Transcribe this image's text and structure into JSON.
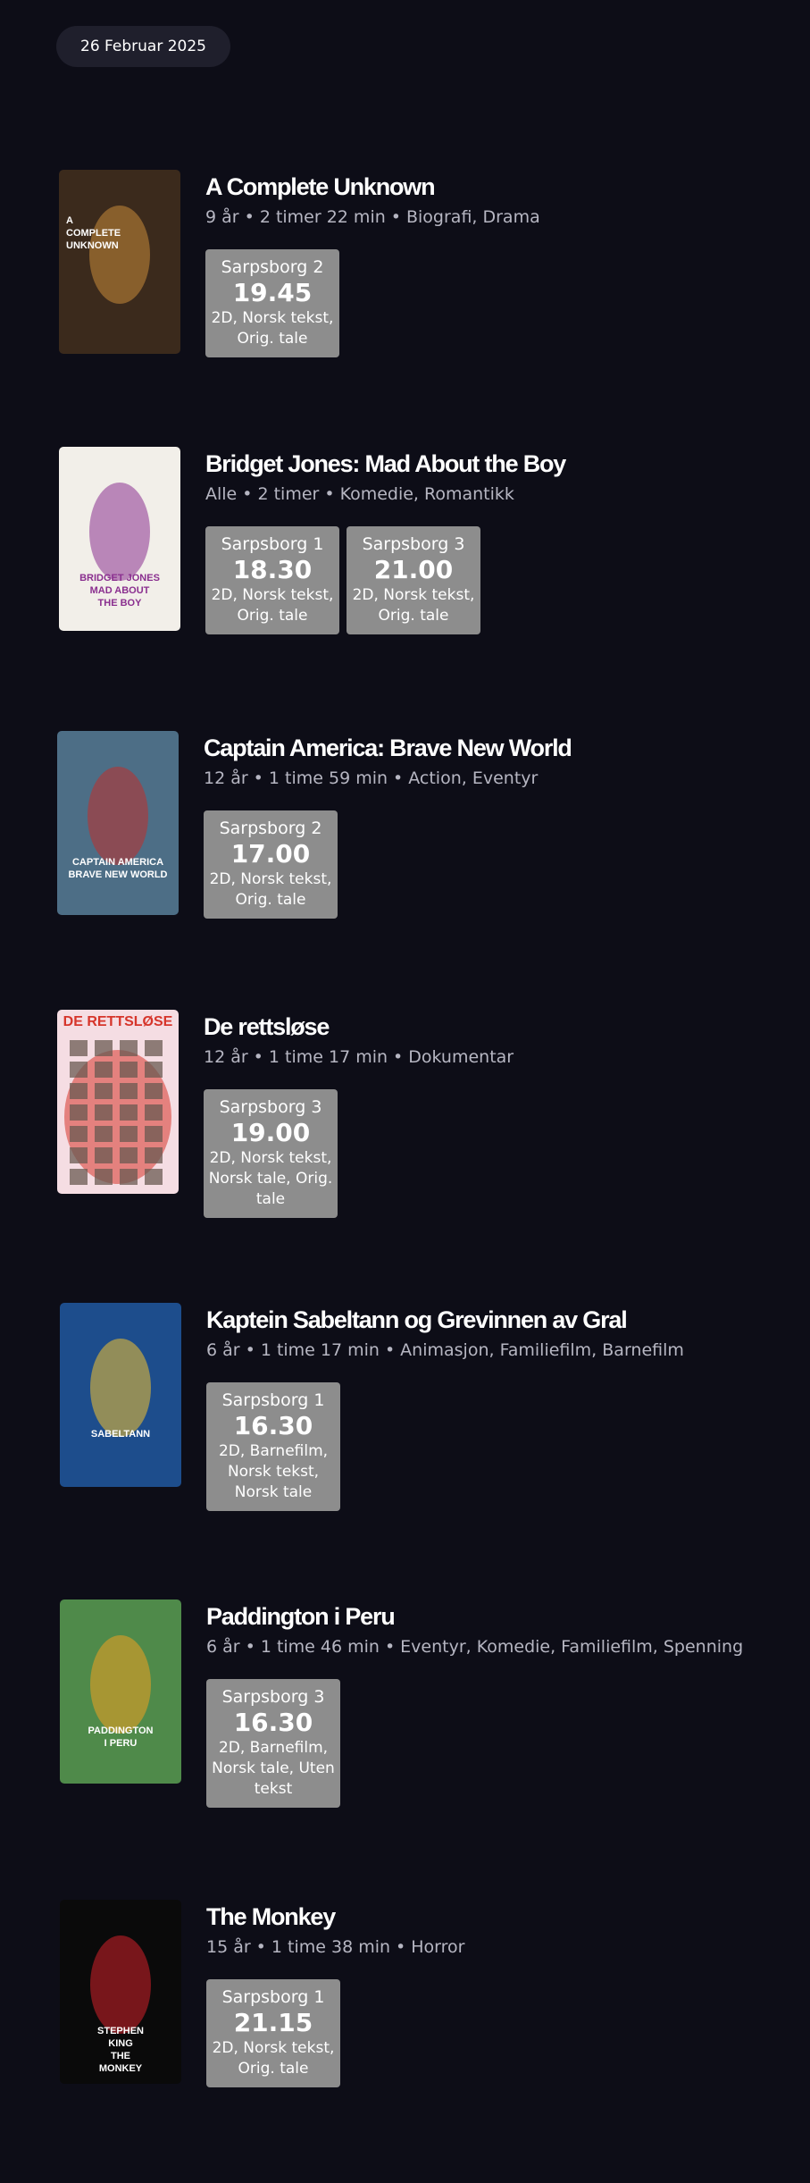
{
  "date": "26 Februar 2025",
  "movies": [
    {
      "title": "A Complete Unknown",
      "age": "9 år",
      "duration": "2 timer 22 min",
      "genres": "Biografi, Drama",
      "sessions": [
        {
          "hall": "Sarpsborg 2",
          "time": "19.45",
          "attr1": "2D, Norsk tekst,",
          "attr2": "Orig. tale",
          "attr3": ""
        }
      ]
    },
    {
      "title": "Bridget Jones: Mad About the Boy",
      "age": "Alle",
      "duration": "2 timer",
      "genres": "Komedie, Romantikk",
      "sessions": [
        {
          "hall": "Sarpsborg 1",
          "time": "18.30",
          "attr1": "2D, Norsk tekst,",
          "attr2": "Orig. tale",
          "attr3": ""
        },
        {
          "hall": "Sarpsborg 3",
          "time": "21.00",
          "attr1": "2D, Norsk tekst,",
          "attr2": "Orig. tale",
          "attr3": ""
        }
      ]
    },
    {
      "title": "Captain America: Brave New World",
      "age": "12 år",
      "duration": "1 time 59 min",
      "genres": "Action, Eventyr",
      "sessions": [
        {
          "hall": "Sarpsborg 2",
          "time": "17.00",
          "attr1": "2D, Norsk tekst,",
          "attr2": "Orig. tale",
          "attr3": ""
        }
      ]
    },
    {
      "title": "De rettsløse",
      "age": "12 år",
      "duration": "1 time 17 min",
      "genres": "Dokumentar",
      "sessions": [
        {
          "hall": "Sarpsborg 3",
          "time": "19.00",
          "attr1": "2D, Norsk tekst,",
          "attr2": "Norsk tale, Orig.",
          "attr3": "tale"
        }
      ]
    },
    {
      "title": "Kaptein Sabeltann og Grevinnen av Gral",
      "age": "6 år",
      "duration": "1 time 17 min",
      "genres": "Animasjon, Familiefilm, Barnefilm",
      "sessions": [
        {
          "hall": "Sarpsborg 1",
          "time": "16.30",
          "attr1": "2D, Barnefilm,",
          "attr2": "Norsk tekst,",
          "attr3": "Norsk tale"
        }
      ]
    },
    {
      "title": "Paddington i Peru",
      "age": "6 år",
      "duration": "1 time 46 min",
      "genres": "Eventyr, Komedie, Familiefilm, Spenning",
      "sessions": [
        {
          "hall": "Sarpsborg 3",
          "time": "16.30",
          "attr1": "2D, Barnefilm,",
          "attr2": "Norsk tale, Uten",
          "attr3": "tekst"
        }
      ]
    },
    {
      "title": "The Monkey",
      "age": "15 år",
      "duration": "1 time 38 min",
      "genres": "Horror",
      "sessions": [
        {
          "hall": "Sarpsborg 1",
          "time": "21.15",
          "attr1": "2D, Norsk tekst,",
          "attr2": "Orig. tale",
          "attr3": ""
        }
      ]
    }
  ],
  "posters": [
    {
      "name": "poster-a-complete-unknown",
      "lines": [
        "A",
        "COMPLETE",
        "UNKNOWN"
      ],
      "bg": "#3b2a1c",
      "accent": "#c98a3b"
    },
    {
      "name": "poster-bridget-jones",
      "lines": [
        "BRIDGET JONES",
        "MAD ABOUT",
        "THE BOY"
      ],
      "bg": "#f2efe9",
      "accent": "#8a2f8f"
    },
    {
      "name": "poster-captain-america",
      "lines": [
        "CAPTAIN AMERICA",
        "BRAVE NEW WORLD"
      ],
      "bg": "#4d6e86",
      "accent": "#c0302b"
    },
    {
      "name": "poster-de-rettslose",
      "lines": [
        "DE RETTSLØSE"
      ],
      "bg": "#f5dde3",
      "accent": "#d6352b"
    },
    {
      "name": "poster-sabeltann",
      "lines": [
        "SABELTANN"
      ],
      "bg": "#1d4d8c",
      "accent": "#f2c230"
    },
    {
      "name": "poster-paddington",
      "lines": [
        "PADDINGTON",
        "I PERU"
      ],
      "bg": "#4f8a4a",
      "accent": "#f0a020"
    },
    {
      "name": "poster-the-monkey",
      "lines": [
        "STEPHEN",
        "KING",
        "THE",
        "MONKEY"
      ],
      "bg": "#0a0a0a",
      "accent": "#d3202a"
    }
  ]
}
